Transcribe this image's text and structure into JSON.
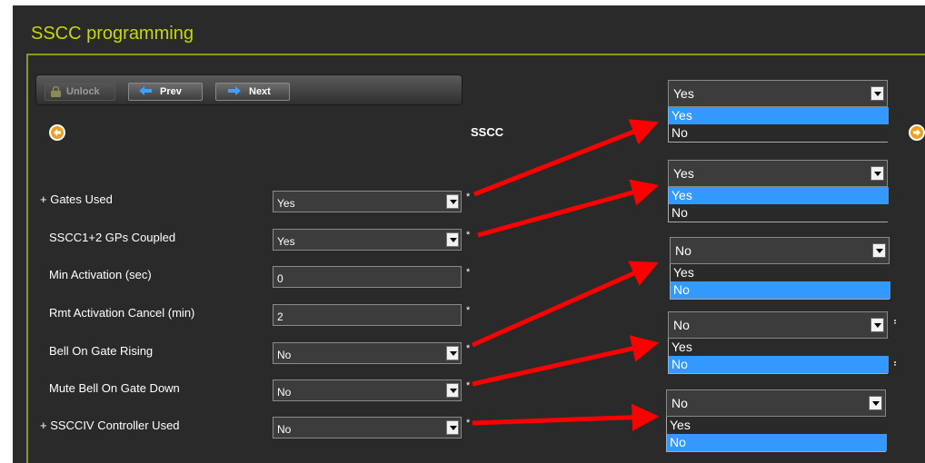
{
  "page_title": "SSCC programming",
  "toolbar": {
    "unlock": "Unlock",
    "prev": "Prev",
    "next": "Next"
  },
  "section_title": "SSCC",
  "required_mark": "*",
  "expand_mark": "+",
  "fields": [
    {
      "label": "Gates Used",
      "value": "Yes",
      "type": "select",
      "expandable": true
    },
    {
      "label": "SSCC1+2 GPs Coupled",
      "value": "Yes",
      "type": "select",
      "expandable": false
    },
    {
      "label": "Min Activation (sec)",
      "value": "0",
      "type": "text",
      "expandable": false
    },
    {
      "label": "Rmt Activation Cancel (min)",
      "value": "2",
      "type": "text",
      "expandable": false
    },
    {
      "label": "Bell On Gate Rising",
      "value": "No",
      "type": "select",
      "expandable": false
    },
    {
      "label": "Mute Bell On Gate Down",
      "value": "No",
      "type": "select",
      "expandable": false
    },
    {
      "label": "SSCCIV Controller Used",
      "value": "No",
      "type": "select",
      "expandable": true
    }
  ],
  "expanded_dropdowns": [
    {
      "value": "Yes",
      "options": [
        "Yes",
        "No"
      ],
      "highlighted": "Yes"
    },
    {
      "value": "Yes",
      "options": [
        "Yes",
        "No"
      ],
      "highlighted": "Yes"
    },
    {
      "value": "No",
      "options": [
        "Yes",
        "No"
      ],
      "highlighted": "No"
    },
    {
      "value": "No",
      "options": [
        "Yes",
        "No"
      ],
      "highlighted": "No"
    },
    {
      "value": "No",
      "options": [
        "Yes",
        "No"
      ],
      "highlighted": "No"
    }
  ],
  "colors": {
    "title": "#c8d800",
    "frame": "#8c9a10",
    "highlight": "#3399ff",
    "arrow": "#ff0000",
    "nav_circle": "#f0a020"
  }
}
